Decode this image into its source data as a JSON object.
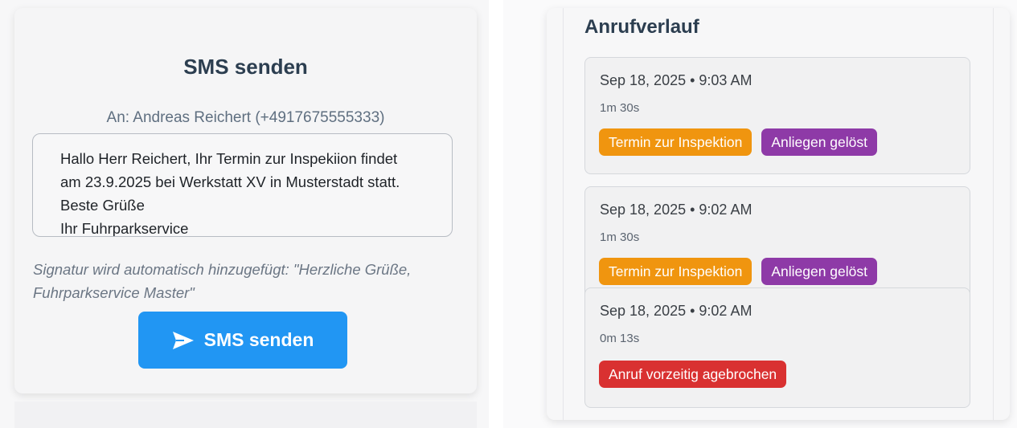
{
  "sms": {
    "title": "SMS senden",
    "recipient": "An: Andreas Reichert (+4917675555333)",
    "message_lines": [
      "Hallo Herr Reichert, Ihr Termin zur Inspekiion findet",
      "am 23.9.2025 bei Werkstatt XV in Musterstadt statt.",
      "Beste Grüße",
      "Ihr Fuhrparkservice"
    ],
    "signature_note": "Signatur wird automatisch hinzugefügt: \"Herzliche Grüße, Fuhrparkservice Master\"",
    "send_label": "SMS senden",
    "send_icon": "send-icon"
  },
  "history": {
    "title": "Anrufverlauf",
    "calls": [
      {
        "date": "Sep 18, 2025 • 9:03 AM",
        "duration": "1m 30s",
        "tags": [
          {
            "label": "Termin zur Inspektion",
            "color": "#f0950f"
          },
          {
            "label": "Anliegen gelöst",
            "color": "#8e3aa7"
          }
        ]
      },
      {
        "date": "Sep 18, 2025 • 9:02 AM",
        "duration": "1m 30s",
        "tags": [
          {
            "label": "Termin zur Inspektion",
            "color": "#f0950f"
          },
          {
            "label": "Anliegen gelöst",
            "color": "#8e3aa7"
          }
        ]
      },
      {
        "date": "Sep 18, 2025 • 9:02 AM",
        "duration": "0m 13s",
        "tags": [
          {
            "label": "Anruf vorzeitig agebrochen",
            "color": "#d93131"
          }
        ]
      }
    ]
  },
  "colors": {
    "primary": "#2196f3",
    "heading": "#2c3e50"
  }
}
